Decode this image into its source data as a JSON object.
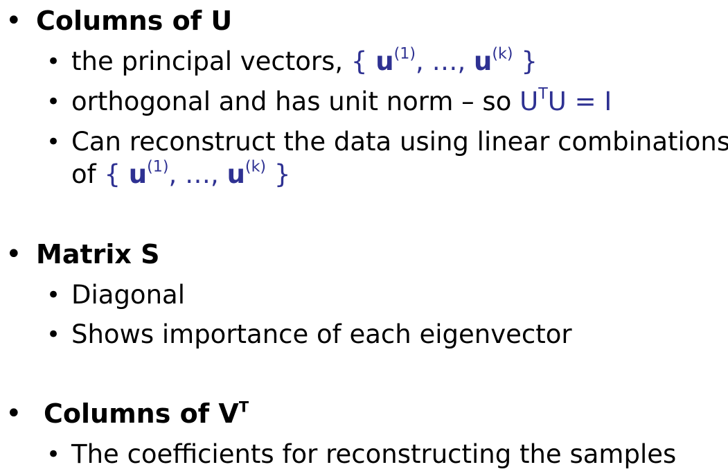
{
  "sections": [
    {
      "heading": "Columns of U",
      "items": [
        {
          "text": "the principal vectors, ",
          "math": {
            "open": "{ ",
            "var1": "u",
            "sup1": "(1)",
            "mid": ", …, ",
            "var2": "u",
            "sup2": "(k)",
            "close": " }"
          }
        },
        {
          "text": "orthogonal and has unit norm – so ",
          "math": {
            "a": "U",
            "sup": "T",
            "b": "U = I"
          }
        },
        {
          "line1": "Can reconstruct the data using linear combinations",
          "line2": "of ",
          "math": {
            "open": "{ ",
            "var1": "u",
            "sup1": "(1)",
            "mid": ", …, ",
            "var2": "u",
            "sup2": "(k)",
            "close": " }"
          }
        }
      ]
    },
    {
      "heading": "Matrix S",
      "items": [
        {
          "text": "Diagonal"
        },
        {
          "text": "Shows importance of each eigenvector"
        }
      ]
    },
    {
      "heading": "Columns of V",
      "heading_sup": "T",
      "items": [
        {
          "text": "The coefficients for reconstructing the samples"
        }
      ]
    }
  ],
  "colors": {
    "text": "#000000",
    "math": "#2e3192"
  },
  "bullet_glyph": "•"
}
